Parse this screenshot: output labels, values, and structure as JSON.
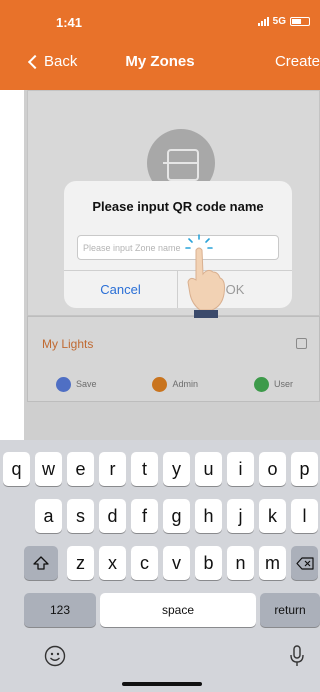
{
  "status": {
    "time": "1:41",
    "network": "5G"
  },
  "nav": {
    "back_label": "Back",
    "title": "My Zones",
    "create_label": "Create"
  },
  "zone_card": {
    "name": "My Lights",
    "actions": [
      {
        "label": "Save",
        "icon": "save-icon",
        "color": "#4f6fc4"
      },
      {
        "label": "Admin",
        "icon": "admin-icon",
        "color": "#c9741e"
      },
      {
        "label": "User",
        "icon": "user-icon",
        "color": "#3d9a4a"
      }
    ]
  },
  "dialog": {
    "title": "Please input QR code name",
    "input_placeholder": "Please input Zone name",
    "input_value": "",
    "cancel_label": "Cancel",
    "ok_label": "OK"
  },
  "keyboard": {
    "row1": [
      "q",
      "w",
      "e",
      "r",
      "t",
      "y",
      "u",
      "i",
      "o",
      "p"
    ],
    "row2": [
      "a",
      "s",
      "d",
      "f",
      "g",
      "h",
      "j",
      "k",
      "l"
    ],
    "row3": [
      "z",
      "x",
      "c",
      "v",
      "b",
      "n",
      "m"
    ],
    "shift_icon": "shift-icon",
    "delete_icon": "delete-icon",
    "numbers_label": "123",
    "space_label": "space",
    "return_label": "return",
    "emoji_icon": "emoji-icon",
    "mic_icon": "microphone-icon"
  },
  "colors": {
    "accent": "#e8722a",
    "link": "#2a6fd6"
  }
}
